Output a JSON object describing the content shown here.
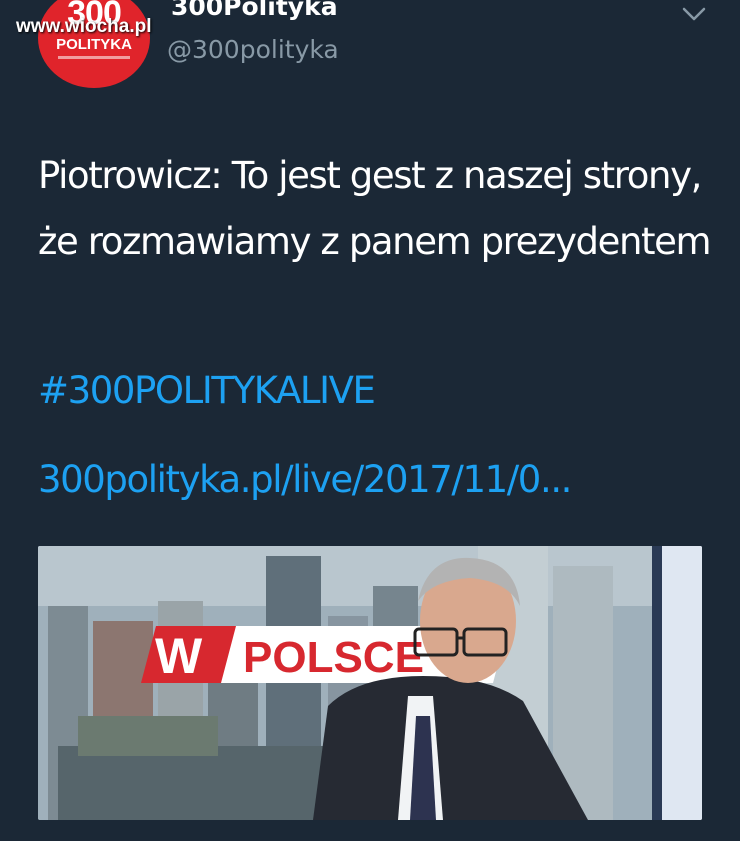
{
  "tweet": {
    "display_name": "300Polityka",
    "handle": "@300polityka",
    "text": "Piotrowicz: To jest gest z naszej strony, że rozmawiamy z panem prezydentem",
    "hashtag": "#300POLITYKALIVE",
    "link": "300polityka.pl/live/2017/11/0..."
  },
  "avatar": {
    "number": "300",
    "label": "POLITYKA"
  },
  "watermark": "www.wiocha.pl",
  "media": {
    "banner_w": "W",
    "banner_text": "POLSCE"
  },
  "icons": {
    "menu": "chevron-down-icon"
  },
  "colors": {
    "background": "#1b2836",
    "link": "#1da1f2",
    "secondary_text": "#8899a6",
    "avatar": "#e0242b",
    "banner_red": "#d7282f"
  }
}
